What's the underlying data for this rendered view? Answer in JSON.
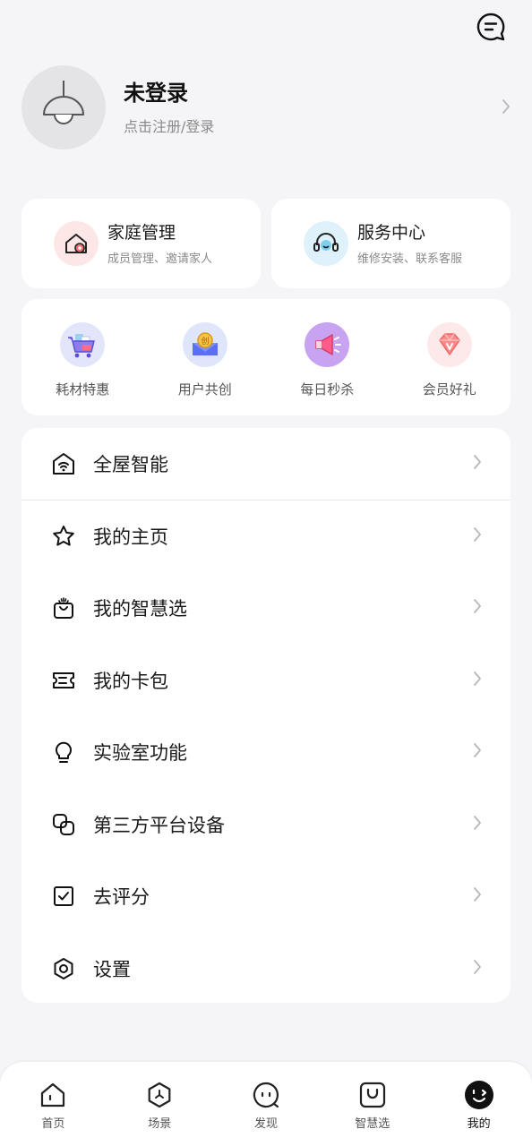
{
  "header": {
    "message_icon": "message-icon"
  },
  "profile": {
    "name": "未登录",
    "subtitle": "点击注册/登录",
    "avatar_icon": "lamp-icon"
  },
  "quick_cards": [
    {
      "title": "家庭管理",
      "subtitle": "成员管理、邀请家人",
      "icon": "home-settings-icon",
      "icon_bg": "#fde6e6"
    },
    {
      "title": "服务中心",
      "subtitle": "维修安装、联系客服",
      "icon": "headset-icon",
      "icon_bg": "#dff1fb"
    }
  ],
  "promos": [
    {
      "label": "耗材特惠",
      "icon": "cart-icon"
    },
    {
      "label": "用户共创",
      "icon": "co-create-icon"
    },
    {
      "label": "每日秒杀",
      "icon": "megaphone-icon"
    },
    {
      "label": "会员好礼",
      "icon": "diamond-icon"
    }
  ],
  "menu": [
    {
      "label": "全屋智能",
      "icon": "smart-home-icon"
    },
    {
      "label": "我的主页",
      "icon": "star-icon"
    },
    {
      "label": "我的智慧选",
      "icon": "smart-bag-icon"
    },
    {
      "label": "我的卡包",
      "icon": "ticket-icon"
    },
    {
      "label": "实验室功能",
      "icon": "bulb-icon"
    },
    {
      "label": "第三方平台设备",
      "icon": "link-icon"
    },
    {
      "label": "去评分",
      "icon": "check-square-icon"
    },
    {
      "label": "设置",
      "icon": "settings-icon"
    }
  ],
  "tabs": [
    {
      "label": "首页",
      "icon": "home-icon"
    },
    {
      "label": "场景",
      "icon": "scene-icon"
    },
    {
      "label": "发现",
      "icon": "discover-icon"
    },
    {
      "label": "智慧选",
      "icon": "shop-bag-icon"
    },
    {
      "label": "我的",
      "icon": "me-icon",
      "active": true
    }
  ],
  "colors": {
    "background": "#f5f5f7",
    "card": "#ffffff",
    "text": "#1a1a1a",
    "secondary": "#8a8a8a"
  }
}
